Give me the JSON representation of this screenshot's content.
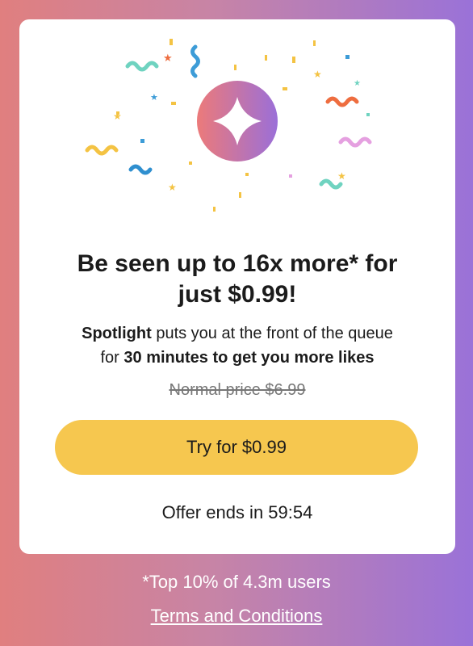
{
  "headline": {
    "line1": "Be seen up to 16x more* for",
    "line2": "just $0.99!"
  },
  "description": {
    "line1_bold": "Spotlight",
    "line1_rest": " puts you at the front of the queue",
    "line2_pre": "for ",
    "line2_bold": "30 minutes to get you more likes"
  },
  "normal_price": "Normal price $6.99",
  "cta_label": "Try for $0.99",
  "offer_text": "Offer ends in 59:54",
  "footnote": "*Top 10% of 4.3m users",
  "terms_link": "Terms and Conditions",
  "icons": {
    "badge": "sparkle-star-icon"
  },
  "colors": {
    "cta": "#f6c74f",
    "badge_gradient_start": "#ec7a7a",
    "badge_gradient_end": "#9b6fd8"
  }
}
